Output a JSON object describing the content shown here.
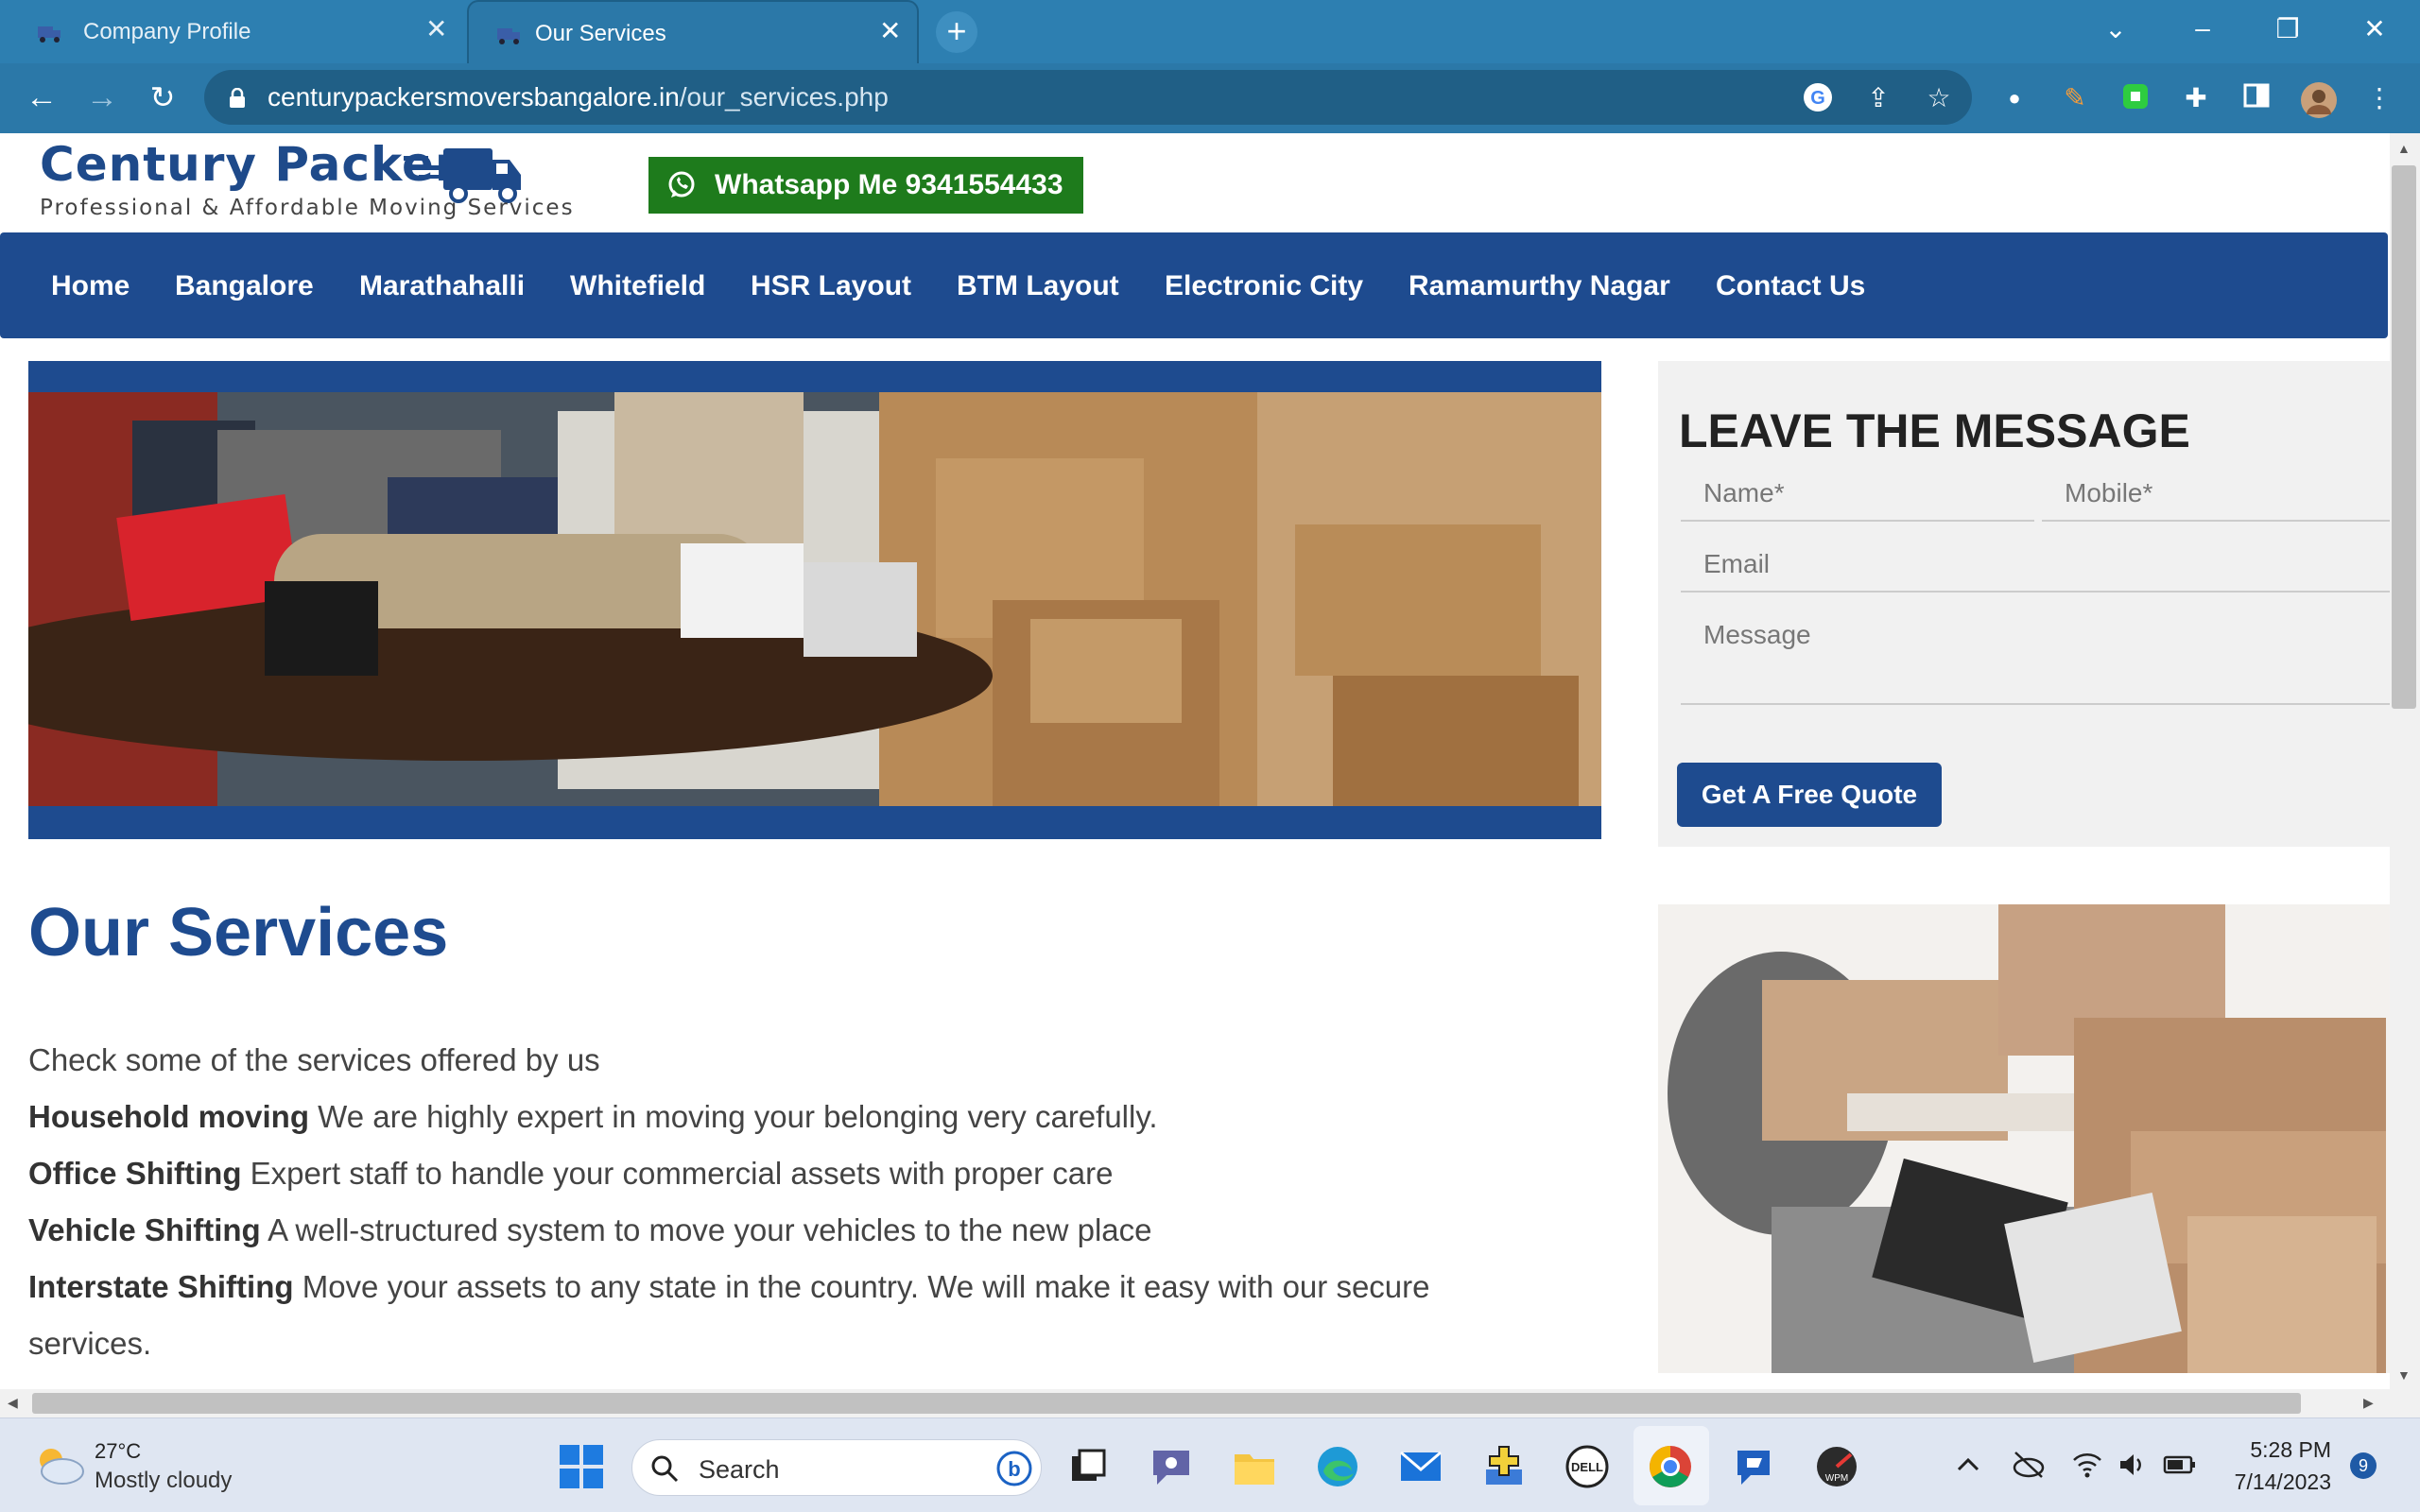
{
  "browser": {
    "tabs": [
      {
        "title": "Company Profile"
      },
      {
        "title": "Our Services"
      }
    ],
    "url_host": "centurypackersmoversbangalore.in",
    "url_path": "/our_services.php"
  },
  "site": {
    "logo_name": "Century Packers",
    "logo_tagline": "Professional & Affordable Moving Services",
    "whatsapp_label": "Whatsapp Me 9341554433",
    "nav": [
      "Home",
      "Bangalore",
      "Marathahalli",
      "Whitefield",
      "HSR Layout",
      "BTM Layout",
      "Electronic City",
      "Ramamurthy Nagar",
      "Contact Us"
    ]
  },
  "form": {
    "title": "LEAVE THE MESSAGE",
    "name_placeholder": "Name*",
    "mobile_placeholder": "Mobile*",
    "email_placeholder": "Email",
    "message_placeholder": "Message",
    "submit_label": "Get A Free Quote"
  },
  "services": {
    "title": "Our Services",
    "intro": "Check some of the services offered by us",
    "items": [
      {
        "name": "Household moving",
        "desc": "We are highly expert in moving your belonging very carefully."
      },
      {
        "name": "Office Shifting",
        "desc": "Expert staff to handle your commercial assets with proper care"
      },
      {
        "name": "Vehicle Shifting",
        "desc": "A well-structured system to move your vehicles to the new place"
      },
      {
        "name": "Interstate Shifting",
        "desc": "Move your assets to any state in the country. We will make it easy with our secure"
      }
    ],
    "continuation": "services."
  },
  "taskbar": {
    "temperature": "27°C",
    "weather": "Mostly cloudy",
    "search_label": "Search",
    "time": "5:28 PM",
    "date": "7/14/2023",
    "notifications": "9"
  },
  "colors": {
    "brand_blue": "#1e4b8f",
    "whatsapp_green": "#1e7b1c",
    "browser_frame": "#2b78a8"
  }
}
